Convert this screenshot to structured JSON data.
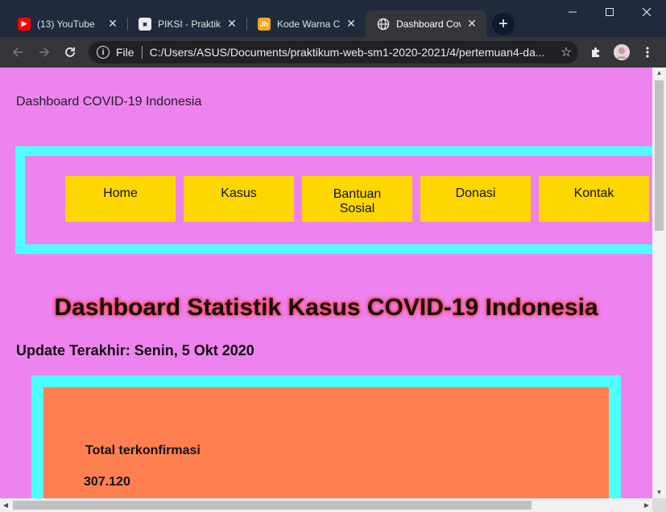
{
  "browser": {
    "tabs": [
      {
        "title": "(13) YouTube",
        "icon": "youtube-icon",
        "active": false
      },
      {
        "title": "PIKSI - Praktikum",
        "icon": "portrait-icon",
        "active": false
      },
      {
        "title": "Kode Warna CSS",
        "icon": "jh-icon",
        "active": false
      },
      {
        "title": "Dashboard Covid",
        "icon": "globe-icon",
        "active": true
      }
    ],
    "favicon_jh_text": "Jh",
    "address": {
      "scheme": "File",
      "url": "C:/Users/ASUS/Documents/praktikum-web-sm1-2020-2021/4/pertemuan4-da..."
    }
  },
  "page": {
    "site_title": "Dashboard COVID-19 Indonesia",
    "nav": [
      {
        "label": "Home"
      },
      {
        "label": "Kasus"
      },
      {
        "label": "Bantuan\nSosial"
      },
      {
        "label": "Donasi"
      },
      {
        "label": "Kontak"
      }
    ],
    "headline": "Dashboard Statistik Kasus COVID-19 Indonesia",
    "update": "Update Terakhir: Senin, 5 Okt 2020",
    "stats": {
      "label": "Total terkonfirmasi",
      "value": "307.120"
    }
  },
  "colors": {
    "page_background": "#ee82ee",
    "nav_border": "#4dffff",
    "nav_item": "#ffd700",
    "stat_box": "#ff7f50",
    "headline_glow": "#ff3b3b"
  }
}
